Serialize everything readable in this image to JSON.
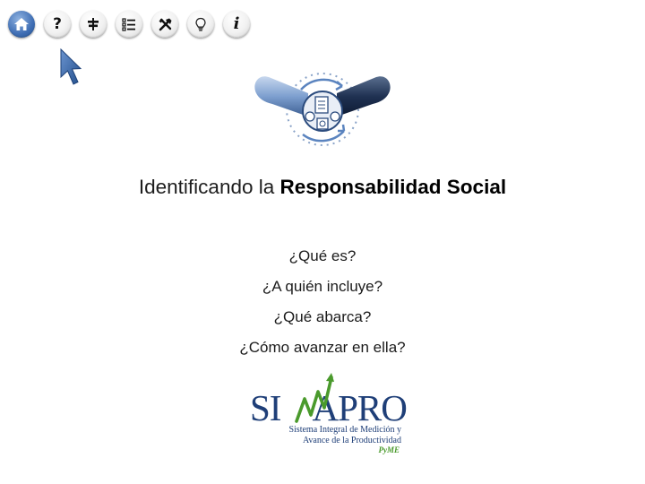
{
  "toolbar": {
    "buttons": [
      {
        "name": "home",
        "icon": "home-icon",
        "active": true
      },
      {
        "name": "help",
        "icon": "question-mark-icon",
        "label": "?"
      },
      {
        "name": "map",
        "icon": "signpost-icon"
      },
      {
        "name": "index",
        "icon": "list-icon"
      },
      {
        "name": "tools",
        "icon": "tools-icon"
      },
      {
        "name": "tips",
        "icon": "lightbulb-icon"
      },
      {
        "name": "info",
        "icon": "info-icon",
        "label": "i"
      }
    ],
    "active_color": "#3f6eb4"
  },
  "title": {
    "prefix": "Identificando la",
    "emphasis": "Responsabilidad Social"
  },
  "menu": {
    "items": [
      {
        "label": "¿Qué es?"
      },
      {
        "label": "¿A quién incluye?"
      },
      {
        "label": "¿Qué abarca?"
      },
      {
        "label": "¿Cómo avanzar en ella?"
      }
    ]
  },
  "logo": {
    "word_left": "SI",
    "word_right": "APRO",
    "line1": "Sistema Integral de Medición y",
    "line2": "Avance de la Productividad",
    "sub": "PyME",
    "brand_color": "#1f3f78",
    "accent_color": "#4a9a2c"
  }
}
